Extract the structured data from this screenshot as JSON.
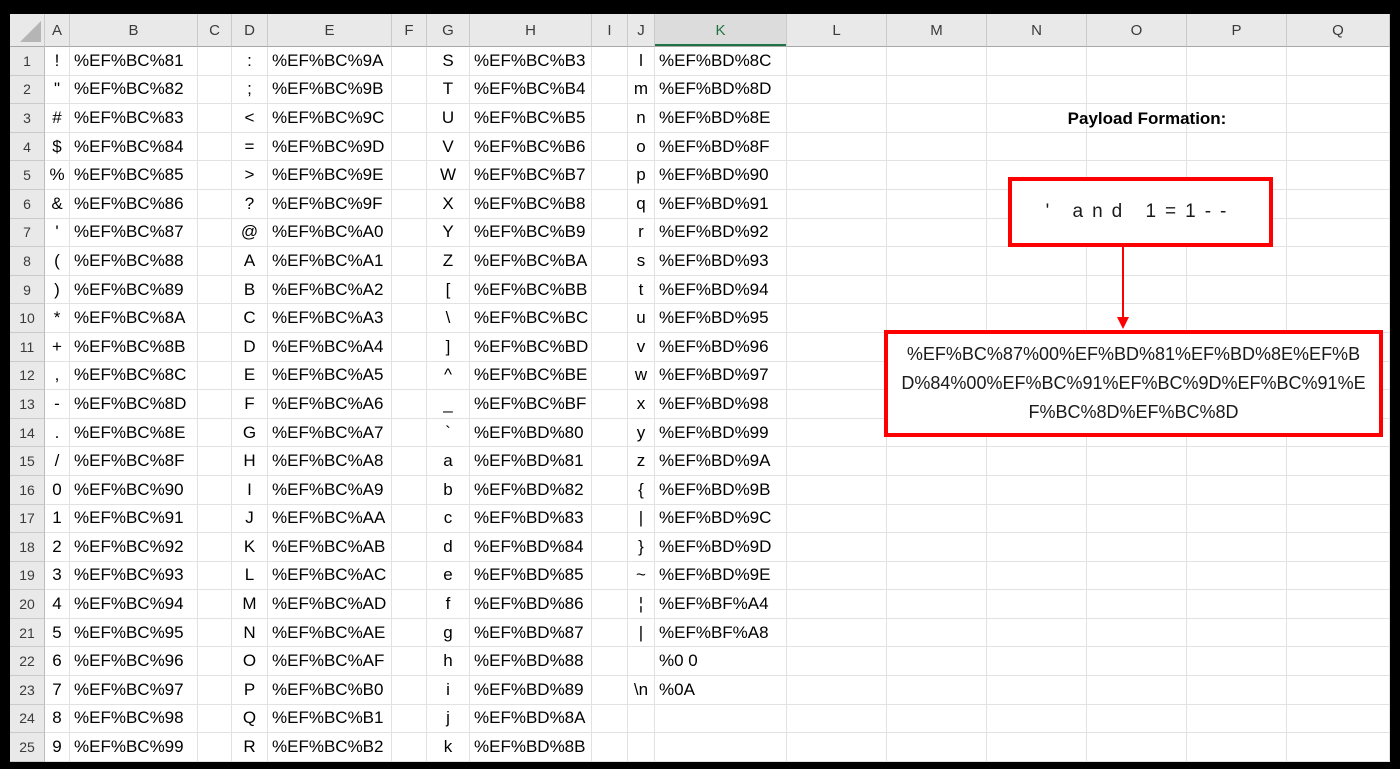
{
  "sheet": {
    "column_headers": [
      "A",
      "B",
      "C",
      "D",
      "E",
      "F",
      "G",
      "H",
      "I",
      "J",
      "K",
      "L",
      "M",
      "N",
      "O",
      "P",
      "Q"
    ],
    "selected_column": "K",
    "rows": [
      {
        "num": "1",
        "a": "!",
        "b": "%EF%BC%81",
        "d": ":",
        "e": "%EF%BC%9A",
        "g": "S",
        "h": "%EF%BC%B3",
        "j": "l",
        "k": "%EF%BD%8C"
      },
      {
        "num": "2",
        "a": "\"",
        "b": "%EF%BC%82",
        "d": ";",
        "e": "%EF%BC%9B",
        "g": "T",
        "h": "%EF%BC%B4",
        "j": "m",
        "k": "%EF%BD%8D"
      },
      {
        "num": "3",
        "a": "#",
        "b": "%EF%BC%83",
        "d": "<",
        "e": "%EF%BC%9C",
        "g": "U",
        "h": "%EF%BC%B5",
        "j": "n",
        "k": "%EF%BD%8E"
      },
      {
        "num": "4",
        "a": "$",
        "b": "%EF%BC%84",
        "d": "=",
        "e": "%EF%BC%9D",
        "g": "V",
        "h": "%EF%BC%B6",
        "j": "o",
        "k": "%EF%BD%8F"
      },
      {
        "num": "5",
        "a": "%",
        "b": "%EF%BC%85",
        "d": ">",
        "e": "%EF%BC%9E",
        "g": "W",
        "h": "%EF%BC%B7",
        "j": "p",
        "k": "%EF%BD%90"
      },
      {
        "num": "6",
        "a": "&",
        "b": "%EF%BC%86",
        "d": "?",
        "e": "%EF%BC%9F",
        "g": "X",
        "h": "%EF%BC%B8",
        "j": "q",
        "k": "%EF%BD%91"
      },
      {
        "num": "7",
        "a": "'",
        "b": "%EF%BC%87",
        "d": "@",
        "e": "%EF%BC%A0",
        "g": "Y",
        "h": "%EF%BC%B9",
        "j": "r",
        "k": "%EF%BD%92"
      },
      {
        "num": "8",
        "a": "(",
        "b": "%EF%BC%88",
        "d": "A",
        "e": "%EF%BC%A1",
        "g": "Z",
        "h": "%EF%BC%BA",
        "j": "s",
        "k": "%EF%BD%93"
      },
      {
        "num": "9",
        "a": ")",
        "b": "%EF%BC%89",
        "d": "B",
        "e": "%EF%BC%A2",
        "g": "[",
        "h": "%EF%BC%BB",
        "j": "t",
        "k": "%EF%BD%94"
      },
      {
        "num": "10",
        "a": "*",
        "b": "%EF%BC%8A",
        "d": "C",
        "e": "%EF%BC%A3",
        "g": "\\",
        "h": "%EF%BC%BC",
        "j": "u",
        "k": "%EF%BD%95"
      },
      {
        "num": "11",
        "a": "+",
        "b": "%EF%BC%8B",
        "d": "D",
        "e": "%EF%BC%A4",
        "g": "]",
        "h": "%EF%BC%BD",
        "j": "v",
        "k": "%EF%BD%96"
      },
      {
        "num": "12",
        "a": ",",
        "b": "%EF%BC%8C",
        "d": "E",
        "e": "%EF%BC%A5",
        "g": "^",
        "h": "%EF%BC%BE",
        "j": "w",
        "k": "%EF%BD%97"
      },
      {
        "num": "13",
        "a": "-",
        "b": "%EF%BC%8D",
        "d": "F",
        "e": "%EF%BC%A6",
        "g": "_",
        "h": "%EF%BC%BF",
        "j": "x",
        "k": "%EF%BD%98"
      },
      {
        "num": "14",
        "a": ".",
        "b": "%EF%BC%8E",
        "d": "G",
        "e": "%EF%BC%A7",
        "g": "`",
        "h": "%EF%BD%80",
        "j": "y",
        "k": "%EF%BD%99"
      },
      {
        "num": "15",
        "a": "/",
        "b": "%EF%BC%8F",
        "d": "H",
        "e": "%EF%BC%A8",
        "g": "a",
        "h": "%EF%BD%81",
        "j": "z",
        "k": "%EF%BD%9A"
      },
      {
        "num": "16",
        "a": "0",
        "b": "%EF%BC%90",
        "d": "I",
        "e": "%EF%BC%A9",
        "g": "b",
        "h": "%EF%BD%82",
        "j": "{",
        "k": "%EF%BD%9B"
      },
      {
        "num": "17",
        "a": "1",
        "b": "%EF%BC%91",
        "d": "J",
        "e": "%EF%BC%AA",
        "g": "c",
        "h": "%EF%BD%83",
        "j": "|",
        "k": "%EF%BD%9C"
      },
      {
        "num": "18",
        "a": "2",
        "b": "%EF%BC%92",
        "d": "K",
        "e": "%EF%BC%AB",
        "g": "d",
        "h": "%EF%BD%84",
        "j": "}",
        "k": "%EF%BD%9D"
      },
      {
        "num": "19",
        "a": "3",
        "b": "%EF%BC%93",
        "d": "L",
        "e": "%EF%BC%AC",
        "g": "e",
        "h": "%EF%BD%85",
        "j": "~",
        "k": "%EF%BD%9E"
      },
      {
        "num": "20",
        "a": "4",
        "b": "%EF%BC%94",
        "d": "M",
        "e": "%EF%BC%AD",
        "g": "f",
        "h": "%EF%BD%86",
        "j": "¦",
        "k": "%EF%BF%A4"
      },
      {
        "num": "21",
        "a": "5",
        "b": "%EF%BC%95",
        "d": "N",
        "e": "%EF%BC%AE",
        "g": "g",
        "h": "%EF%BD%87",
        "j": "|",
        "k": "%EF%BF%A8"
      },
      {
        "num": "22",
        "a": "6",
        "b": "%EF%BC%96",
        "d": "O",
        "e": "%EF%BC%AF",
        "g": "h",
        "h": "%EF%BD%88",
        "j": "",
        "k": "%0 0"
      },
      {
        "num": "23",
        "a": "7",
        "b": "%EF%BC%97",
        "d": "P",
        "e": "%EF%BC%B0",
        "g": "i",
        "h": "%EF%BD%89",
        "j": "\\n",
        "k": "%0A"
      },
      {
        "num": "24",
        "a": "8",
        "b": "%EF%BC%98",
        "d": "Q",
        "e": "%EF%BC%B1",
        "g": "j",
        "h": "%EF%BD%8A",
        "j": "",
        "k": ""
      },
      {
        "num": "25",
        "a": "9",
        "b": "%EF%BC%99",
        "d": "R",
        "e": "%EF%BC%B2",
        "g": "k",
        "h": "%EF%BD%8B",
        "j": "",
        "k": ""
      }
    ]
  },
  "annotation": {
    "title": "Payload Formation:",
    "payload_plain": "' and 1=1--",
    "payload_encoded": "%EF%BC%87%00%EF%BD%81%EF%BD%8E%EF%BD%84%00%EF%BC%91%EF%BC%9D%EF%BC%91%EF%BC%8D%EF%BC%8D"
  },
  "colors": {
    "annotation_red": "#ff0000",
    "selected_header_green": "#217346",
    "header_bg": "#e9e9e9",
    "selected_header_bg": "#dcdcdc",
    "gridline": "#e2e2e2"
  }
}
